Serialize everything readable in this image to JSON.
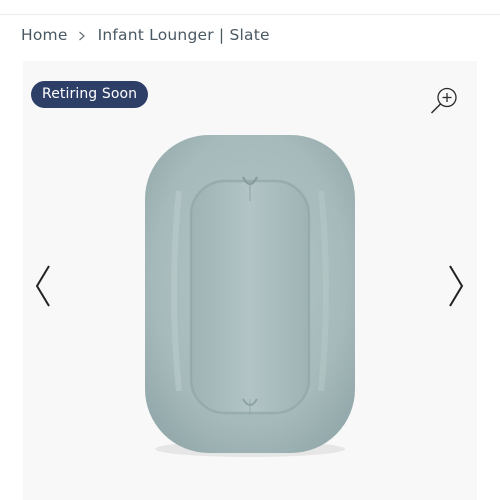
{
  "breadcrumb": {
    "items": [
      {
        "label": "Home"
      },
      {
        "label": "Infant Lounger | Slate"
      }
    ]
  },
  "gallery": {
    "badge": "Retiring Soon",
    "zoom_icon": "zoom-in-icon",
    "prev_icon": "chevron-left-icon",
    "next_icon": "chevron-right-icon",
    "product_image": "infant-lounger-slate",
    "colors": {
      "badge_bg": "#2e3f67",
      "product": "#a9bdbe"
    }
  }
}
